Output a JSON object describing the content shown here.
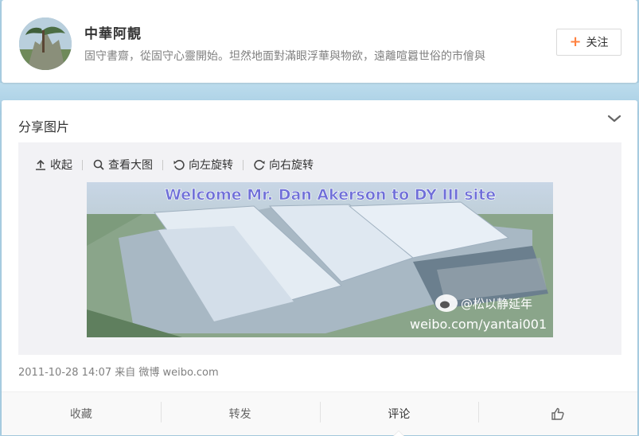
{
  "profile": {
    "name": "中華阿靚",
    "bio": "固守書齋，從固守心靈開始。坦然地面對滿眼浮華與物欲，遠離喧囂世俗的市儈與",
    "follow_label": "关注"
  },
  "post": {
    "title": "分享图片",
    "toolbar": {
      "collapse_label": "收起",
      "view_large_label": "查看大图",
      "rotate_left_label": "向左旋转",
      "rotate_right_label": "向右旋转"
    },
    "photo": {
      "banner_text": "Welcome  Mr. Dan Akerson to DY III site",
      "watermark_handle": "@松以静延年",
      "watermark_url": "weibo.com/yantai001"
    },
    "meta": "2011-10-28 14:07 来自 微博 weibo.com",
    "actions": {
      "favorite_label": "收藏",
      "repost_label": "转发",
      "comment_label": "评论"
    }
  },
  "colors": {
    "accent_orange": "#ff8140",
    "page_bg": "#a9cfe4"
  }
}
